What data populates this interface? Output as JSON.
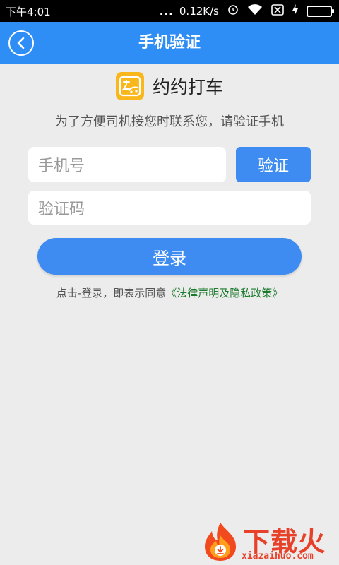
{
  "status_bar": {
    "time": "下午4:01",
    "dots": "...",
    "network_speed": "0.12K/s",
    "icons": [
      "alarm-icon",
      "wifi-icon",
      "no-sim-icon",
      "charging-icon",
      "battery-icon"
    ]
  },
  "app_bar": {
    "title": "手机验证",
    "back_icon": "chevron-left-icon"
  },
  "brand": {
    "logo_glyph": "约",
    "name": "约约打车"
  },
  "subtitle": "为了方便司机接您时联系您，请验证手机",
  "form": {
    "phone_placeholder": "手机号",
    "verify_label": "验证",
    "code_placeholder": "验证码",
    "login_label": "登录"
  },
  "agreement": {
    "prefix": "点击-登录，即表示同意",
    "link": "《法律声明及隐私政策》"
  },
  "watermark": {
    "text": "下载火",
    "url": "xiazaihuo.com"
  },
  "colors": {
    "app_bar": "#2f8df6",
    "button": "#3e8cf1",
    "brand_logo": "#f9b71b",
    "link": "#1c7a2c",
    "watermark": "#e8412a"
  }
}
